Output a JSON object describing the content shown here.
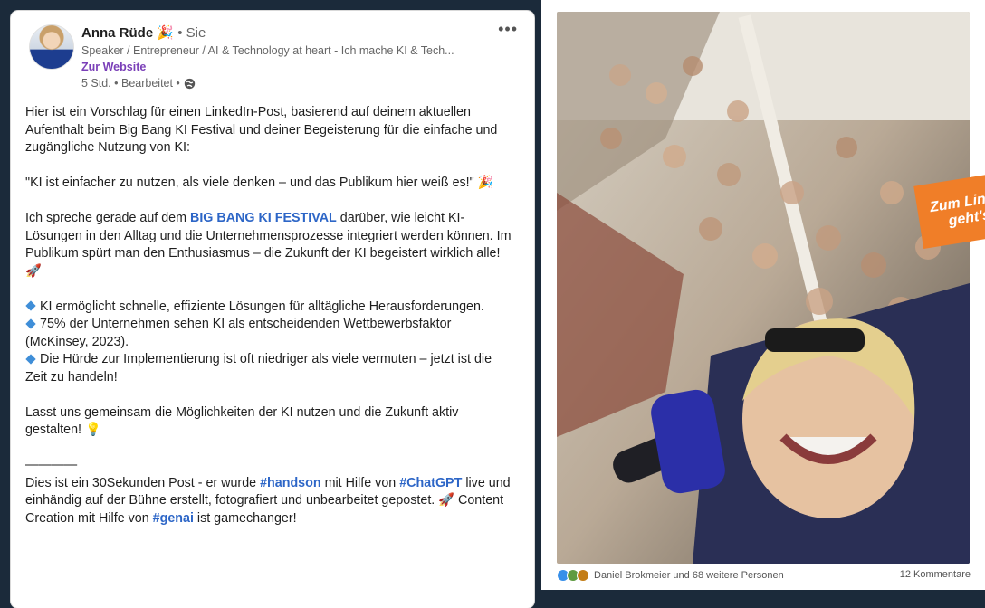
{
  "post": {
    "author_name": "Anna Rüde",
    "author_emoji": "🎉",
    "connection": "• Sie",
    "headline": "Speaker / Entrepreneur / AI & Technology at heart - Ich mache KI & Tech...",
    "website_link": "Zur Website",
    "timestamp": "5 Std. • Bearbeitet •",
    "more_label": "•••",
    "p1": "Hier ist ein Vorschlag für einen LinkedIn-Post, basierend auf deinem aktuellen Aufenthalt beim Big Bang KI Festival und deiner Begeisterung für die einfache und zugängliche Nutzung von KI:",
    "p2": "\"KI ist einfacher zu nutzen, als viele denken – und das Publikum hier weiß es!\" 🎉",
    "p3_before": "Ich spreche gerade auf dem ",
    "p3_link": "BIG BANG KI FESTIVAL",
    "p3_after": " darüber, wie leicht KI-Lösungen in den Alltag und die Unternehmensprozesse integriert werden können. Im Publikum spürt man den Enthusiasmus – die Zukunft der KI begeistert wirklich alle! 🚀",
    "bullet1": "KI ermöglicht schnelle, effiziente Lösungen für alltägliche Herausforderungen.",
    "bullet2": "75% der Unternehmen sehen KI als entscheidenden Wettbewerbsfaktor (McKinsey, 2023).",
    "bullet3": "Die Hürde zur Implementierung ist oft niedriger als viele vermuten – jetzt ist die Zeit zu handeln!",
    "p5": "Lasst uns gemeinsam die Möglichkeiten der KI nutzen und die Zukunft aktiv gestalten! 💡",
    "divider": "————",
    "p6_a": "Dies ist ein 30Sekunden Post - er wurde ",
    "hashtag1": "#handson",
    "p6_b": " mit Hilfe von ",
    "hashtag2": "#ChatGPT",
    "p6_c": " live und einhändig auf der Bühne erstellt, fotografiert und unbearbeitet gepostet. 🚀 Content Creation mit Hilfe von ",
    "hashtag3": "#genai",
    "p6_d": " ist gamechanger!"
  },
  "media": {
    "overlay_line1": "Zum Lin",
    "overlay_line2": "geht's",
    "reactions_label": "Daniel Brokmeier und 68 weitere Personen",
    "comments_label": "12 Kommentare"
  },
  "colors": {
    "accent_orange": "#f07e28",
    "link_blue": "#2d66c7",
    "website_purple": "#7a3fb8"
  }
}
